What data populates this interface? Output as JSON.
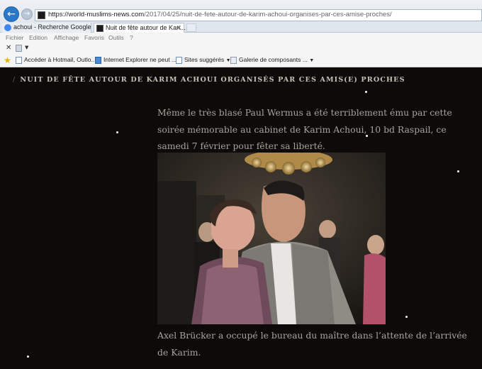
{
  "browser": {
    "url_host": "https://world-muslims-news.com",
    "url_path": "/2017/04/25/nuit-de-fete-autour-de-karim-achoui-organises-par-ces-amise-proches/",
    "tabs": [
      {
        "label": "achoui - Recherche Google"
      },
      {
        "label": "Nuit de fête autour de Kari..."
      }
    ],
    "menu": [
      "Fichier",
      "Edition",
      "Affichage",
      "Favoris",
      "Outils",
      "?"
    ],
    "favorites": [
      {
        "label": "Accéder à Hotmail, Outlo..."
      },
      {
        "label": "Internet Explorer ne peut ..."
      },
      {
        "label": "Sites suggérés"
      },
      {
        "label": "Galerie de composants ..."
      }
    ]
  },
  "article": {
    "headline": "NUIT DE FÊTE AUTOUR DE KARIM ACHOUI ORGANISÉS PAR CES AMIS(E) PROCHES",
    "paragraph1": "Même le très blasé Paul Wermus a été terriblement ému par cette soirée mémorable au cabinet de Karim Achoui, 10 bd Raspail, ce samedi 7 février pour fêter sa liberté.",
    "paragraph2": "Axel Brücker a occupé le bureau du maître dans l’attente de l’arrivée de Karim."
  },
  "colors": {
    "page_background": "#0c0b0a",
    "body_text": "#a9a39a",
    "headline_text": "#c7c1b6",
    "link_blue": "#2a78c9"
  }
}
